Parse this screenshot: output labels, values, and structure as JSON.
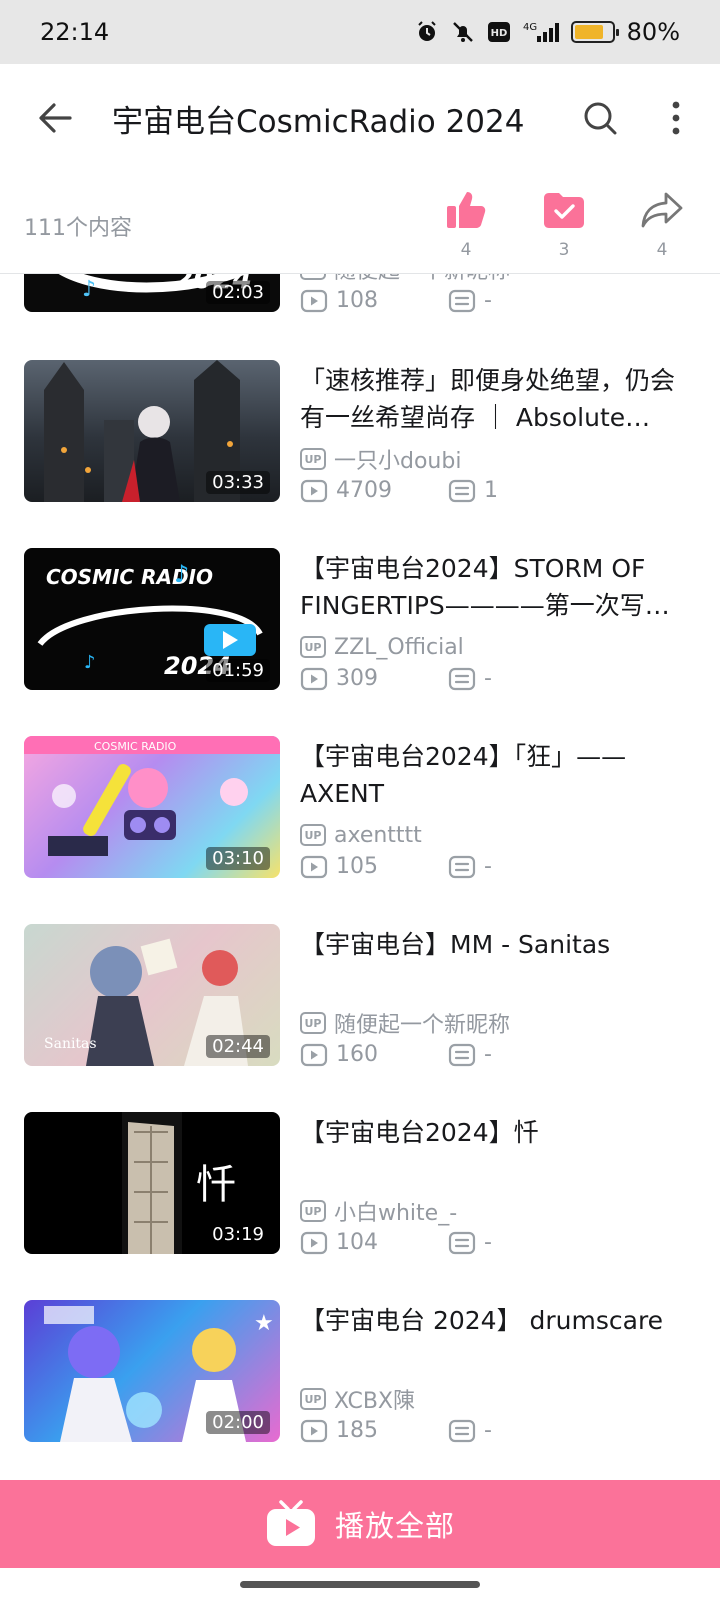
{
  "status": {
    "time": "22:14",
    "network": "4G",
    "battery": "80%",
    "battery_level": 0.8
  },
  "header": {
    "title": "宇宙电台CosmicRadio 2024"
  },
  "actions": {
    "count": "111个内容",
    "like": "4",
    "favorite": "3",
    "share": "4"
  },
  "items": [
    {
      "title": "",
      "uploader": "随便起一个新昵称",
      "duration": "02:03",
      "plays": "108",
      "comments": "-"
    },
    {
      "title": "「速核推荐」即便身处绝望，仍会有一丝希望尚存 ｜ Absolute…",
      "uploader": "一只小doubi",
      "duration": "03:33",
      "plays": "4709",
      "comments": "1"
    },
    {
      "title": "【宇宙电台2024】STORM OF FINGERTIPS————第一次写…",
      "uploader": "ZZL_Official",
      "duration": "01:59",
      "plays": "309",
      "comments": "-"
    },
    {
      "title": "【宇宙电台2024】「狂」——AXENT",
      "uploader": "axentttt",
      "duration": "03:10",
      "plays": "105",
      "comments": "-"
    },
    {
      "title": "【宇宙电台】MM - Sanitas",
      "uploader": "随便起一个新昵称",
      "duration": "02:44",
      "plays": "160",
      "comments": "-"
    },
    {
      "title": "【宇宙电台2024】忏",
      "uploader": "小白white_-",
      "duration": "03:19",
      "plays": "104",
      "comments": "-"
    },
    {
      "title": "【宇宙电台 2024】 drumscare",
      "uploader": "XCBX陳",
      "duration": "02:00",
      "plays": "185",
      "comments": "-"
    }
  ],
  "thumb_text": {
    "cosmic": "COSMIC RADIO",
    "year": "2024",
    "sanitas": "Sanitas",
    "qian": "忏"
  },
  "bottom": {
    "play_all": "播放全部"
  },
  "colors": {
    "accent": "#fb7299",
    "text_secondary": "#9499a0"
  }
}
